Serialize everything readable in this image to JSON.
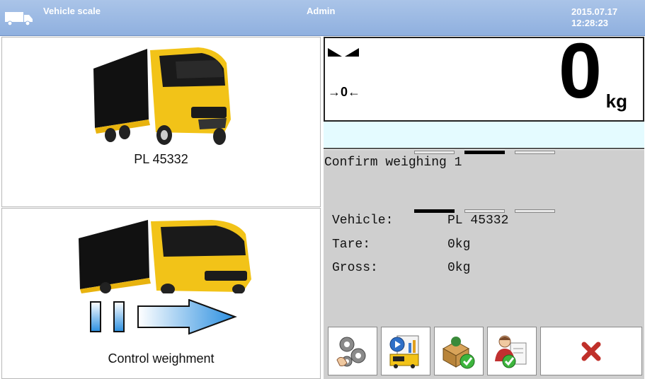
{
  "header": {
    "app_title": "Vehicle scale",
    "user": "Admin",
    "date": "2015.07.17",
    "time": "12:28:23"
  },
  "tiles": {
    "vehicle_plate": "PL 45332",
    "control_label": "Control weighment"
  },
  "display": {
    "weight_value": "0",
    "unit": "kg",
    "zero_indicator": "→0←",
    "stable_icon": "stable-indicator-icon"
  },
  "weighing": {
    "title": "Confirm weighing 1",
    "rows": [
      {
        "label": "Vehicle:",
        "value": "PL 45332"
      },
      {
        "label": "Tare:",
        "value": "0kg"
      },
      {
        "label": "Gross:",
        "value": "0kg"
      }
    ],
    "top_progress_active": 2,
    "mid_progress_active": 1
  },
  "buttons": [
    {
      "icon": "settings-gears-icon"
    },
    {
      "icon": "weighing-report-icon"
    },
    {
      "icon": "products-confirm-icon"
    },
    {
      "icon": "user-documents-icon"
    },
    {
      "icon": "cancel-x-icon"
    }
  ],
  "colors": {
    "header_blue": "#9db9e3",
    "cyan_bar": "#e4fbff",
    "panel_gray": "#cfcfcf",
    "cancel_red": "#c0302a",
    "truck_yellow": "#f2c318"
  }
}
